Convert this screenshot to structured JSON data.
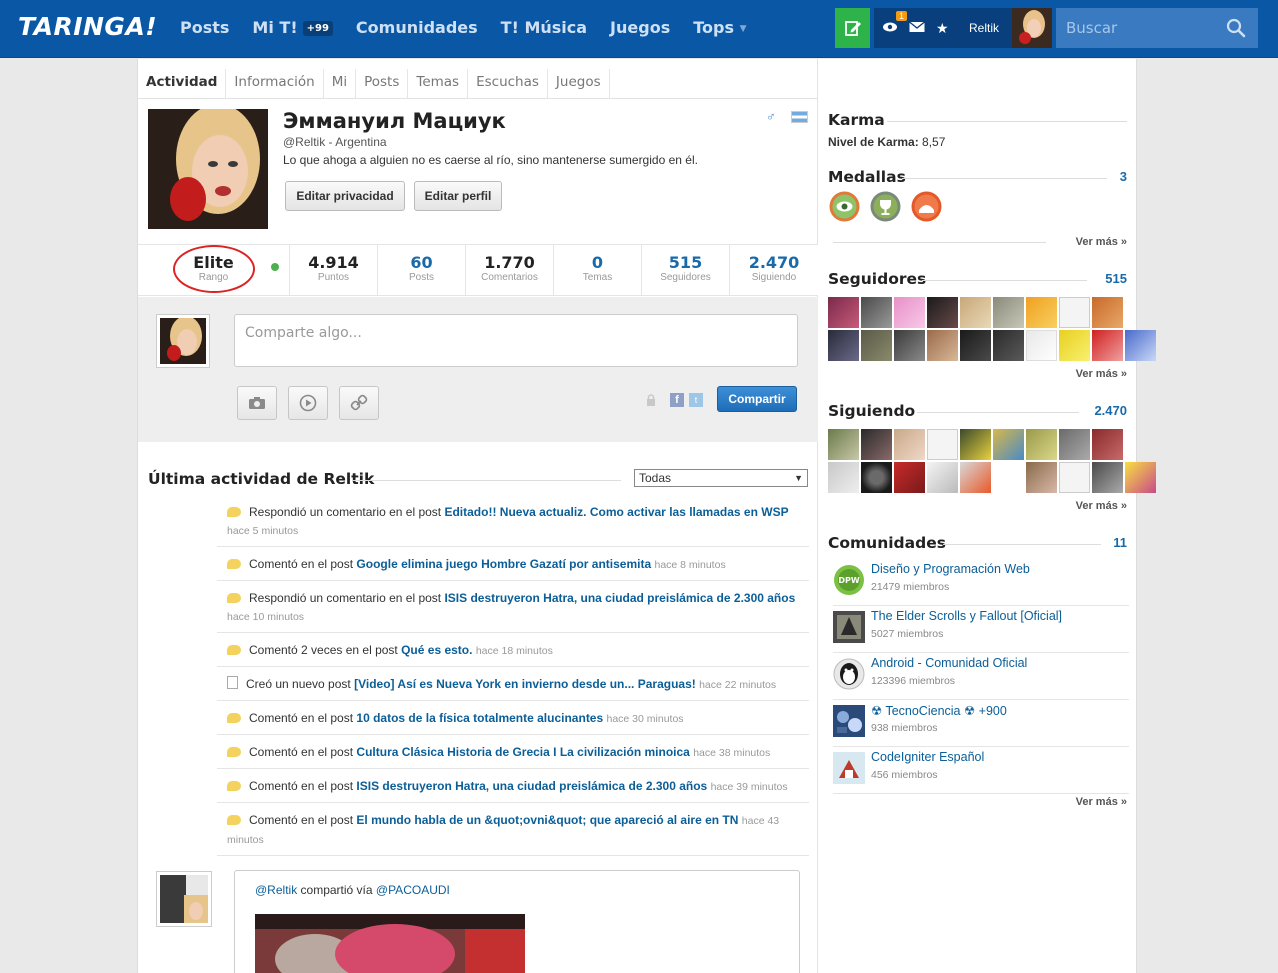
{
  "header": {
    "logo": "TARINGA!",
    "nav": [
      {
        "label": "Posts"
      },
      {
        "label": "Mi T!",
        "badge": "+99"
      },
      {
        "label": "Comunidades"
      },
      {
        "label": "T! Música"
      },
      {
        "label": "Juegos"
      },
      {
        "label": "Tops"
      }
    ],
    "notifications_badge": "1",
    "username": "Reltik",
    "search_placeholder": "Buscar"
  },
  "tabs": [
    "Actividad",
    "Información",
    "Mi",
    "Posts",
    "Temas",
    "Escuchas",
    "Juegos"
  ],
  "profile": {
    "name": "Эммануил Мациук",
    "handle": "@Reltik - Argentina",
    "bio": "Lo que ahoga a alguien no es caerse al río, sino mantenerse sumergido en él.",
    "btn_privacy": "Editar privacidad",
    "btn_edit": "Editar perfil"
  },
  "stats": [
    {
      "value": "Elite",
      "label": "Rango"
    },
    {
      "value": "4.914",
      "label": "Puntos"
    },
    {
      "value": "60",
      "label": "Posts"
    },
    {
      "value": "1.770",
      "label": "Comentarios"
    },
    {
      "value": "0",
      "label": "Temas"
    },
    {
      "value": "515",
      "label": "Seguidores"
    },
    {
      "value": "2.470",
      "label": "Siguiendo"
    }
  ],
  "share": {
    "placeholder": "Comparte algo...",
    "button": "Compartir"
  },
  "activity": {
    "title": "Última actividad de Reltik",
    "filter": "Todas",
    "items": [
      {
        "icon": "comment",
        "text": "Respondió un comentario en el post ",
        "link": "Editado!! Nueva actualiz. Como activar las llamadas en WSP",
        "time": "hace 5 minutos",
        "br": true
      },
      {
        "icon": "comment",
        "text": "Comentó en el post ",
        "link": "Google elimina juego Hombre Gazatí por antisemita",
        "time": "hace 8 minutos"
      },
      {
        "icon": "comment",
        "text": "Respondió un comentario en el post ",
        "link": "ISIS destruyeron Hatra, una ciudad preislámica de 2.300 años",
        "time": "hace 10 minutos"
      },
      {
        "icon": "comment",
        "text": "Comentó 2 veces en el post ",
        "link": "Qué es esto.",
        "time": "hace 18 minutos"
      },
      {
        "icon": "doc",
        "text": "Creó un nuevo post ",
        "link": "[Video] Así es Nueva York en invierno desde un... Paraguas!",
        "time": "hace 22 minutos"
      },
      {
        "icon": "comment",
        "text": "Comentó en el post ",
        "link": "10 datos de la física totalmente alucinantes",
        "time": "hace 30 minutos"
      },
      {
        "icon": "comment",
        "text": "Comentó en el post ",
        "link": "Cultura Clásica Historia de Grecia I La civilización minoica",
        "time": "hace 38 minutos"
      },
      {
        "icon": "comment",
        "text": "Comentó en el post ",
        "link": "ISIS destruyeron Hatra, una ciudad preislámica de 2.300 años",
        "time": "hace 39 minutos"
      },
      {
        "icon": "comment",
        "text": "Comentó en el post ",
        "link": "El mundo habla de un &quot;ovni&quot; que apareció al aire en TN",
        "time": "hace 43 minutos"
      }
    ]
  },
  "shared_post": {
    "user": "@Reltik",
    "middle": " compartió vía ",
    "via": "@PACOAUDI"
  },
  "sidebar": {
    "karma_title": "Karma",
    "karma_label": "Nivel de Karma:",
    "karma_value": "8,57",
    "medals_title": "Medallas",
    "medals_count": "3",
    "ver_mas": "Ver más »",
    "followers_title": "Seguidores",
    "followers_count": "515",
    "following_title": "Siguiendo",
    "following_count": "2.470",
    "communities_title": "Comunidades",
    "communities_count": "11",
    "communities": [
      {
        "name": "Diseño y Programación Web",
        "members": "21479 miembros",
        "color": "#7bc144"
      },
      {
        "name": "The Elder Scrolls y Fallout [Oficial]",
        "members": "5027 miembros",
        "color": "#555"
      },
      {
        "name": "Android - Comunidad Oficial",
        "members": "123396 miembros",
        "color": "#333"
      },
      {
        "name": "☢ TecnoCiencia ☢ +900",
        "members": "938 miembros",
        "color": "#2a4a7a"
      },
      {
        "name": "CodeIgniter Español",
        "members": "456 miembros",
        "color": "#c0392b"
      }
    ]
  },
  "colors": {
    "brand": "#0a57a5",
    "accent_green": "#2db34a",
    "link": "#0b5e97"
  }
}
